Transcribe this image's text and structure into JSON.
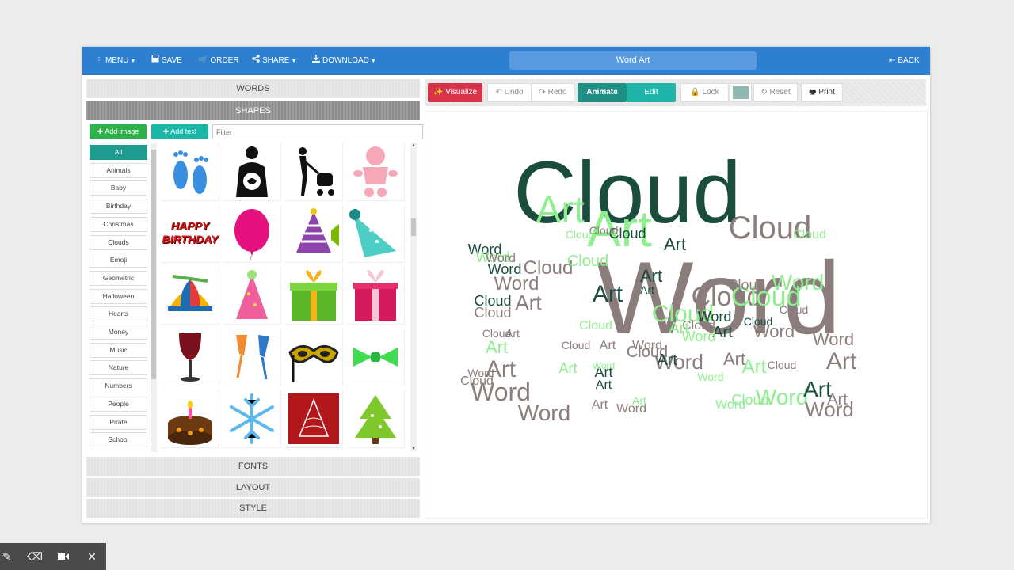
{
  "topbar": {
    "menu": "MENU",
    "save": "SAVE",
    "order": "ORDER",
    "share": "SHARE",
    "download": "DOWNLOAD",
    "title": "Word Art",
    "back": "BACK"
  },
  "sections": {
    "words": "WORDS",
    "shapes": "SHAPES",
    "fonts": "FONTS",
    "layout": "LAYOUT",
    "style": "STYLE"
  },
  "shapes_panel": {
    "add_image": "Add image",
    "add_text": "Add text",
    "filter_placeholder": "Filter",
    "categories": [
      "All",
      "Animals",
      "Baby",
      "Birthday",
      "Christmas",
      "Clouds",
      "Emoji",
      "Geometric",
      "Halloween",
      "Hearts",
      "Money",
      "Music",
      "Nature",
      "Numbers",
      "People",
      "Pirate",
      "School"
    ],
    "selected_category": "All",
    "birthday_text": [
      "HAPPY",
      "BIRTHDAY"
    ],
    "shape_names": [
      "baby-feet",
      "pregnant-woman",
      "woman-stroller",
      "baby",
      "happy-birthday-text",
      "balloon",
      "party-horn-hat",
      "party-hat-teal",
      "propeller-cap",
      "party-hat-pink",
      "gift-green",
      "gift-pink",
      "wine-glass",
      "champagne-glasses",
      "masquerade-mask",
      "bow-tie",
      "birthday-cake",
      "snowflake",
      "christmas-tree-card",
      "christmas-tree"
    ]
  },
  "toolbar": {
    "visualize": "Visualize",
    "undo": "Undo",
    "redo": "Redo",
    "animate": "Animate",
    "edit": "Edit",
    "lock": "Lock",
    "reset": "Reset",
    "print": "Print"
  },
  "colors": {
    "accent_blue": "#2f7fd0",
    "visualize_red": "#d9334a",
    "animate_teal": "#1f8f84",
    "edit_teal": "#20b3a8",
    "add_green": "#2db14a",
    "add_text_teal": "#1ab6a6",
    "swatch": "#8fb9b2",
    "word_dark_green": "#1b4d3e",
    "word_taupe": "#8b7d7b",
    "word_light_green": "#90ee90"
  },
  "wordcloud": {
    "words": [
      {
        "t": "Word",
        "c": "#8b7d7b"
      },
      {
        "t": "Cloud",
        "c": "#1b4d3e"
      },
      {
        "t": "Art",
        "c": "#90ee90"
      },
      {
        "t": "Art",
        "c": "#90ee90"
      },
      {
        "t": "Cloud",
        "c": "#8b7d7b"
      },
      {
        "t": "Cloud",
        "c": "#8b7d7b"
      },
      {
        "t": "Cloud",
        "c": "#90ee90"
      },
      {
        "t": "Word",
        "c": "#90ee90"
      },
      {
        "t": "Art",
        "c": "#1b4d3e"
      },
      {
        "t": "Art",
        "c": "#8b7d7b"
      },
      {
        "t": "Art",
        "c": "#8b7d7b"
      },
      {
        "t": "Word",
        "c": "#8b7d7b"
      },
      {
        "t": "Word",
        "c": "#8b7d7b"
      },
      {
        "t": "Cloud",
        "c": "#90ee90"
      },
      {
        "t": "Word",
        "c": "#90ee90"
      },
      {
        "t": "Art",
        "c": "#8b7d7b"
      },
      {
        "t": "Art",
        "c": "#1b4d3e"
      },
      {
        "t": "Art",
        "c": "#1b4d3e"
      },
      {
        "t": "Cloud",
        "c": "#8b7d7b"
      },
      {
        "t": "Word",
        "c": "#8b7d7b"
      },
      {
        "t": "Word",
        "c": "#1b4d3e"
      },
      {
        "t": "Art",
        "c": "#1b4d3e"
      },
      {
        "t": "Art",
        "c": "#90ee90"
      },
      {
        "t": "Cloud",
        "c": "#8b7d7b"
      },
      {
        "t": "Cloud",
        "c": "#1b4d3e"
      },
      {
        "t": "Cloud",
        "c": "#8b7d7b"
      },
      {
        "t": "Cloud",
        "c": "#8b7d7b"
      },
      {
        "t": "Cloud",
        "c": "#90ee90"
      },
      {
        "t": "Art",
        "c": "#8b7d7b"
      },
      {
        "t": "Art",
        "c": "#1b4d3e"
      },
      {
        "t": "Word",
        "c": "#8b7d7b"
      },
      {
        "t": "Word",
        "c": "#8b7d7b"
      },
      {
        "t": "Word",
        "c": "#8b7d7b"
      },
      {
        "t": "Word",
        "c": "#1b4d3e"
      },
      {
        "t": "Word",
        "c": "#90ee90"
      },
      {
        "t": "Art",
        "c": "#90ee90"
      },
      {
        "t": "Art",
        "c": "#8b7d7b"
      },
      {
        "t": "Cloud",
        "c": "#8b7d7b"
      },
      {
        "t": "Cloud",
        "c": "#90ee90"
      },
      {
        "t": "Cloud",
        "c": "#8b7d7b"
      },
      {
        "t": "Word",
        "c": "#8b7d7b"
      },
      {
        "t": "Word",
        "c": "#90ee90"
      },
      {
        "t": "Art",
        "c": "#90ee90"
      },
      {
        "t": "Art",
        "c": "#1b4d3e"
      },
      {
        "t": "Cloud",
        "c": "#8b7d7b"
      },
      {
        "t": "Cloud",
        "c": "#1b4d3e"
      },
      {
        "t": "Word",
        "c": "#8b7d7b"
      },
      {
        "t": "Word",
        "c": "#90ee90"
      },
      {
        "t": "Art",
        "c": "#8b7d7b"
      },
      {
        "t": "Art",
        "c": "#1b4d3e"
      },
      {
        "t": "Cloud",
        "c": "#8b7d7b"
      },
      {
        "t": "Cloud",
        "c": "#90ee90"
      },
      {
        "t": "Word",
        "c": "#1b4d3e"
      },
      {
        "t": "Word",
        "c": "#8b7d7b"
      },
      {
        "t": "Art",
        "c": "#1b4d3e"
      },
      {
        "t": "Art",
        "c": "#90ee90"
      },
      {
        "t": "Cloud",
        "c": "#8b7d7b"
      },
      {
        "t": "Cloud",
        "c": "#1b4d3e"
      },
      {
        "t": "Word",
        "c": "#8b7d7b"
      },
      {
        "t": "Word",
        "c": "#90ee90"
      },
      {
        "t": "Art",
        "c": "#8b7d7b"
      },
      {
        "t": "Art",
        "c": "#90ee90"
      },
      {
        "t": "Cloud",
        "c": "#90ee90"
      },
      {
        "t": "Cloud",
        "c": "#8b7d7b"
      },
      {
        "t": "Word",
        "c": "#8b7d7b"
      },
      {
        "t": "Word",
        "c": "#90ee90"
      },
      {
        "t": "Art",
        "c": "#1b4d3e"
      },
      {
        "t": "Art",
        "c": "#8b7d7b"
      },
      {
        "t": "Cloud",
        "c": "#8b7d7b"
      },
      {
        "t": "Cloud",
        "c": "#90ee90"
      }
    ]
  }
}
